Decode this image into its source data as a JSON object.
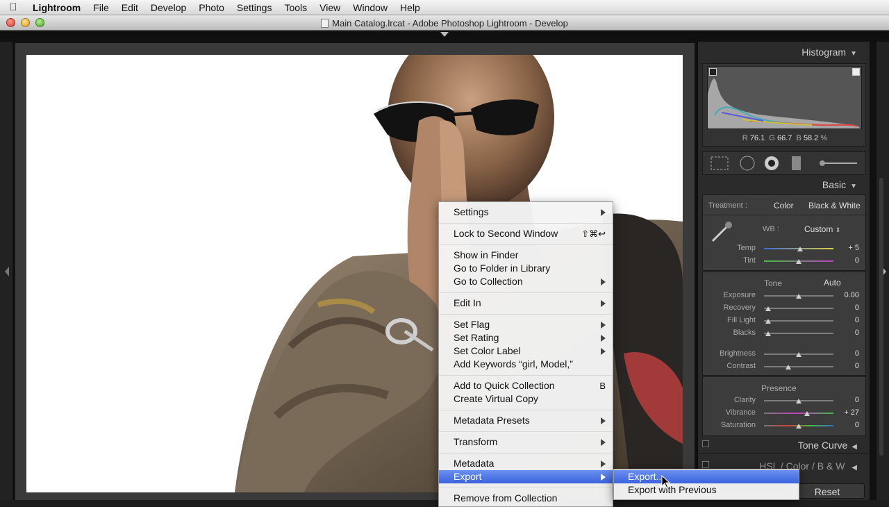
{
  "menubar": {
    "app": "Lightroom",
    "items": [
      "File",
      "Edit",
      "Develop",
      "Photo",
      "Settings",
      "Tools",
      "View",
      "Window",
      "Help"
    ]
  },
  "window": {
    "title": "Main Catalog.lrcat - Adobe Photoshop Lightroom - Develop"
  },
  "right_panel": {
    "histogram": {
      "title": "Histogram",
      "r_label": "R",
      "r": "76.1",
      "g_label": "G",
      "g": "66.7",
      "b_label": "B",
      "b": "58.2",
      "unit": "%"
    },
    "basic": {
      "title": "Basic",
      "treatment_label": "Treatment :",
      "treatment_color": "Color",
      "treatment_bw": "Black & White",
      "wb_label": "WB :",
      "wb_value": "Custom",
      "temp": {
        "label": "Temp",
        "value": "+ 5"
      },
      "tint": {
        "label": "Tint",
        "value": "0"
      },
      "tone_label": "Tone",
      "auto_label": "Auto",
      "exposure": {
        "label": "Exposure",
        "value": "0.00"
      },
      "recovery": {
        "label": "Recovery",
        "value": "0"
      },
      "fill_light": {
        "label": "Fill Light",
        "value": "0"
      },
      "blacks": {
        "label": "Blacks",
        "value": "0"
      },
      "brightness": {
        "label": "Brightness",
        "value": "0"
      },
      "contrast": {
        "label": "Contrast",
        "value": "0"
      },
      "presence_label": "Presence",
      "clarity": {
        "label": "Clarity",
        "value": "0"
      },
      "vibrance": {
        "label": "Vibrance",
        "value": "+ 27"
      },
      "saturation": {
        "label": "Saturation",
        "value": "0"
      }
    },
    "tone_curve": "Tone Curve",
    "hsl": {
      "hsl": "HSL",
      "color": "Color",
      "bw": "B & W",
      "slash": "/"
    },
    "reset_label": "Reset"
  },
  "context_menu": {
    "settings": "Settings",
    "lock": "Lock to Second Window",
    "lock_shortcut": "⇧⌘↩",
    "show_finder": "Show in Finder",
    "goto_folder": "Go to Folder in Library",
    "goto_collection": "Go to Collection",
    "edit_in": "Edit In",
    "set_flag": "Set Flag",
    "set_rating": "Set Rating",
    "set_color_label": "Set Color Label",
    "add_keywords": "Add Keywords “girl, Model,”",
    "add_quick": "Add to Quick Collection",
    "add_quick_shortcut": "B",
    "virtual_copy": "Create Virtual Copy",
    "metadata_presets": "Metadata Presets",
    "transform": "Transform",
    "metadata": "Metadata",
    "export": "Export",
    "remove": "Remove from Collection"
  },
  "submenu": {
    "export_dots": "Export...",
    "export_prev": "Export with Previous"
  },
  "colors": {
    "highlight": "#3b63de",
    "panel": "#2b2b2b"
  }
}
